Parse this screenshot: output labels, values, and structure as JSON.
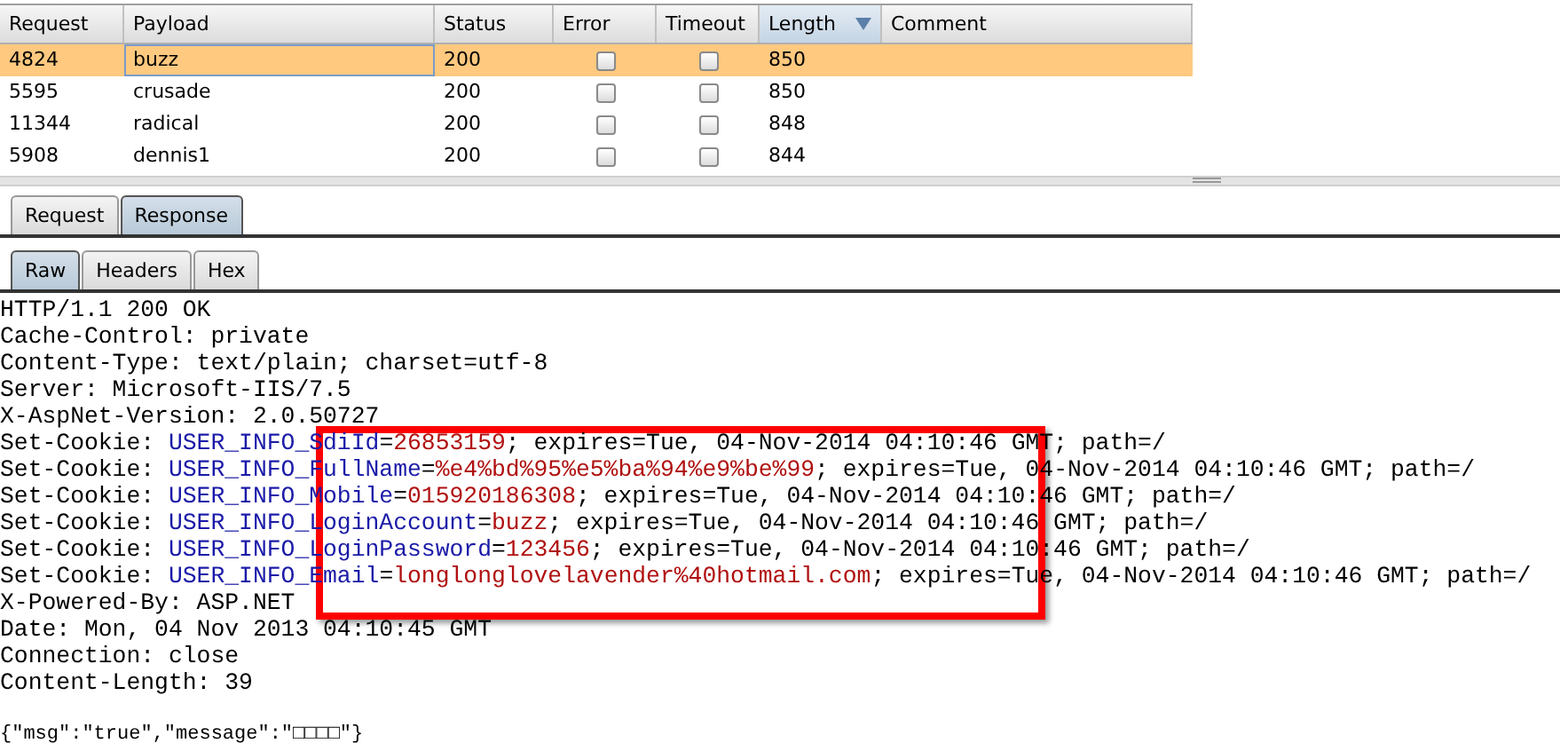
{
  "results_table": {
    "columns": [
      {
        "label": "Request",
        "sorted": false
      },
      {
        "label": "Payload",
        "sorted": false
      },
      {
        "label": "Status",
        "sorted": false
      },
      {
        "label": "Error",
        "sorted": false
      },
      {
        "label": "Timeout",
        "sorted": false
      },
      {
        "label": "Length",
        "sorted": true
      },
      {
        "label": "Comment",
        "sorted": false
      }
    ],
    "rows": [
      {
        "request": "4824",
        "payload": "buzz",
        "status": "200",
        "error": false,
        "timeout": false,
        "length": "850",
        "selected": true
      },
      {
        "request": "5595",
        "payload": "crusade",
        "status": "200",
        "error": false,
        "timeout": false,
        "length": "850",
        "selected": false
      },
      {
        "request": "11344",
        "payload": "radical",
        "status": "200",
        "error": false,
        "timeout": false,
        "length": "848",
        "selected": false
      },
      {
        "request": "5908",
        "payload": "dennis1",
        "status": "200",
        "error": false,
        "timeout": false,
        "length": "844",
        "selected": false
      }
    ]
  },
  "message_tabs": [
    {
      "label": "Request",
      "selected": false
    },
    {
      "label": "Response",
      "selected": true
    }
  ],
  "view_tabs": [
    {
      "label": "Raw",
      "selected": true
    },
    {
      "label": "Headers",
      "selected": false
    },
    {
      "label": "Hex",
      "selected": false
    }
  ],
  "response_lines": [
    {
      "kind": "header",
      "text": "HTTP/1.1 200 OK"
    },
    {
      "kind": "header",
      "text": "Cache-Control: private"
    },
    {
      "kind": "header",
      "text": "Content-Type: text/plain; charset=utf-8"
    },
    {
      "kind": "header",
      "text": "Server: Microsoft-IIS/7.5"
    },
    {
      "kind": "header",
      "text": "X-AspNet-Version: 2.0.50727"
    },
    {
      "kind": "cookie",
      "prefix": "Set-Cookie:",
      "name": "USER_INFO_SdiId",
      "equals": "=",
      "value": "26853159",
      "attributes": "; expires=Tue, 04-Nov-2014 04:10:46 GMT; path=/"
    },
    {
      "kind": "cookie",
      "prefix": "Set-Cookie:",
      "name": "USER_INFO_FullName",
      "equals": "=",
      "value": "%e4%bd%95%e5%ba%94%e9%be%99",
      "attributes": "; expires=Tue, 04-Nov-2014 04:10:46 GMT; path=/"
    },
    {
      "kind": "cookie",
      "prefix": "Set-Cookie:",
      "name": "USER_INFO_Mobile",
      "equals": "=",
      "value": "015920186308",
      "attributes": "; expires=Tue, 04-Nov-2014 04:10:46 GMT; path=/"
    },
    {
      "kind": "cookie",
      "prefix": "Set-Cookie:",
      "name": "USER_INFO_LoginAccount",
      "equals": "=",
      "value": "buzz",
      "attributes": "; expires=Tue, 04-Nov-2014 04:10:46 GMT; path=/"
    },
    {
      "kind": "cookie",
      "prefix": "Set-Cookie:",
      "name": "USER_INFO_LoginPassword",
      "equals": "=",
      "value": "123456",
      "attributes": "; expires=Tue, 04-Nov-2014 04:10:46 GMT; path=/"
    },
    {
      "kind": "cookie",
      "prefix": "Set-Cookie:",
      "name": "USER_INFO_Email",
      "equals": "=",
      "value": "longlonglovelavender%40hotmail.com",
      "attributes": "; expires=Tue, 04-Nov-2014 04:10:46 GMT; path=/"
    },
    {
      "kind": "header",
      "text": "X-Powered-By: ASP.NET"
    },
    {
      "kind": "header",
      "text": "Date: Mon, 04 Nov 2013 04:10:45 GMT"
    },
    {
      "kind": "header",
      "text": "Connection: close"
    },
    {
      "kind": "header",
      "text": "Content-Length: 39"
    },
    {
      "kind": "blank"
    },
    {
      "kind": "body",
      "text": "{\"msg\":\"true\",\"message\":\"□□□□\"}"
    }
  ]
}
